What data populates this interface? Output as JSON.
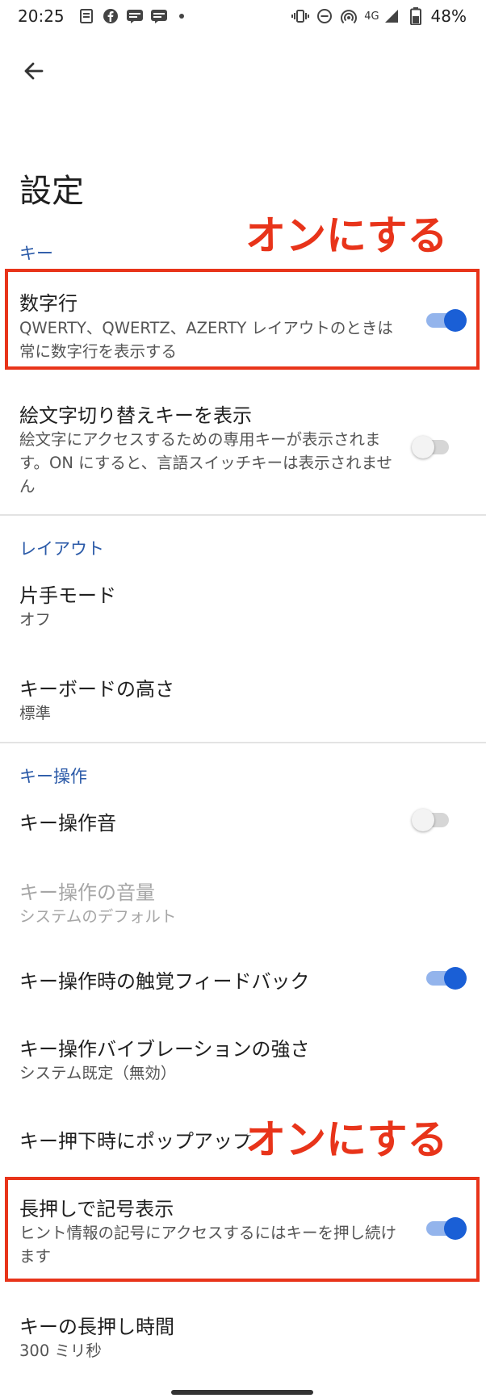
{
  "status_bar": {
    "time": "20:25",
    "network": "4G",
    "battery": "48%",
    "notification_icons": [
      "news-icon",
      "facebook-icon",
      "line-icon",
      "line-icon"
    ],
    "system_icons": [
      "vibrate-icon",
      "dnd-icon",
      "hotspot-icon",
      "signal-icon",
      "battery-icon"
    ]
  },
  "page": {
    "title": "設定"
  },
  "sections": {
    "keys": {
      "header": "キー",
      "number_row": {
        "title": "数字行",
        "desc": "QWERTY、QWERTZ、AZERTY レイアウトのときは常に数字行を表示する",
        "on": true
      },
      "emoji_key": {
        "title": "絵文字切り替えキーを表示",
        "desc": "絵文字にアクセスするための専用キーが表示されます。ON にすると、言語スイッチキーは表示されません",
        "on": false
      }
    },
    "layout": {
      "header": "レイアウト",
      "one_handed": {
        "title": "片手モード",
        "value": "オフ"
      },
      "keyboard_height": {
        "title": "キーボードの高さ",
        "value": "標準"
      }
    },
    "key_press": {
      "header": "キー操作",
      "sound": {
        "title": "キー操作音",
        "on": false
      },
      "volume": {
        "title": "キー操作の音量",
        "value": "システムのデフォルト",
        "disabled": true
      },
      "haptic": {
        "title": "キー操作時の触覚フィードバック",
        "on": true
      },
      "vibration_strength": {
        "title": "キー操作バイブレーションの強さ",
        "value": "システム既定（無効）"
      },
      "popup": {
        "title": "キー押下時にポップアップ"
      },
      "long_press_symbols": {
        "title": "長押しで記号表示",
        "desc": "ヒント情報の記号にアクセスするにはキーを押し続けます",
        "on": true
      },
      "long_press_delay": {
        "title": "キーの長押し時間",
        "value": "300 ミリ秒"
      }
    }
  },
  "annotations": {
    "label_1": "オンにする",
    "label_2": "オンにする",
    "color": "#e8341a"
  },
  "colors": {
    "accent": "#1a5fd6",
    "section_header": "#2b5aa8"
  }
}
